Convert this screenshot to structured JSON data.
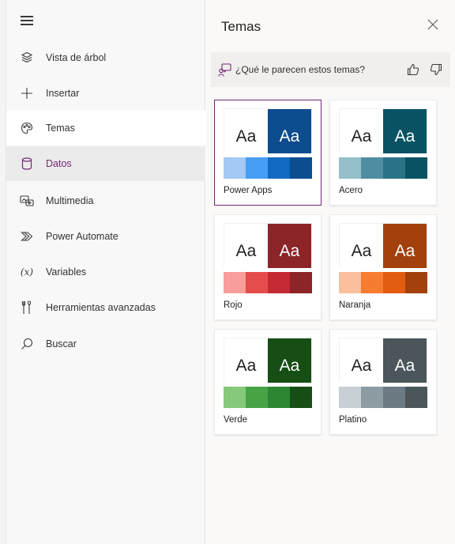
{
  "sidebar": {
    "items": [
      {
        "label": "Vista de árbol"
      },
      {
        "label": "Insertar"
      },
      {
        "label": "Temas"
      },
      {
        "label": "Datos"
      },
      {
        "label": "Multimedia"
      },
      {
        "label": "Power Automate"
      },
      {
        "label": "Variables"
      },
      {
        "label": "Herramientas avanzadas"
      },
      {
        "label": "Buscar"
      }
    ]
  },
  "panel": {
    "title": "Temas",
    "feedback": {
      "text": "¿Qué le parecen estos temas?"
    },
    "sample_text": "Aa",
    "themes": [
      {
        "name": "Power Apps",
        "colors": [
          "#a4c9f5",
          "#479ef5",
          "#1269c1",
          "#0c4d8f"
        ],
        "selected": true
      },
      {
        "name": "Acero",
        "colors": [
          "#95bfca",
          "#4f8ea0",
          "#2a7386",
          "#075364"
        ],
        "selected": false
      },
      {
        "name": "Rojo",
        "colors": [
          "#f99e9b",
          "#e54c4c",
          "#c32a33",
          "#8b2527"
        ],
        "selected": false
      },
      {
        "name": "Naranja",
        "colors": [
          "#fcbf9e",
          "#f67c30",
          "#e35d10",
          "#a2410d"
        ],
        "selected": false
      },
      {
        "name": "Verde",
        "colors": [
          "#86c97b",
          "#46a346",
          "#2d8631",
          "#174e15"
        ],
        "selected": false
      },
      {
        "name": "Platino",
        "colors": [
          "#c7d0d4",
          "#8d9ba2",
          "#6b7a83",
          "#4b565b"
        ],
        "selected": false
      }
    ]
  }
}
